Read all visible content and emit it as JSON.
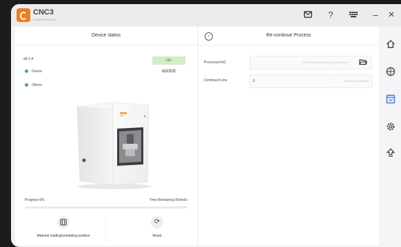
{
  "titlebar": {
    "app_name": "CNC3",
    "app_subtitle": "DOWNSTREAM",
    "icons": [
      "mail-icon",
      "help-icon",
      "keyboard-icon",
      "minimize-icon",
      "close-icon"
    ]
  },
  "device_panel": {
    "title": "Device status",
    "device_id": "s6-1-4",
    "status_items": [
      {
        "label": "Device",
        "color": "#4caf50"
      },
      {
        "label": "Others",
        "color": "#4caf50"
      }
    ],
    "state_badge": "Idle",
    "small_button": "解除警报",
    "progress_label": "Progress 0%",
    "progress_value": 0,
    "time_label": "Time Remaining 0h0m0s",
    "actions": [
      {
        "label": "Material loading/unloading position",
        "icon": "load-position-icon"
      },
      {
        "label": "Reset",
        "icon": "reset-icon"
      }
    ]
  },
  "process_panel": {
    "title": "Re-continue Process",
    "processed_nc": {
      "label": "Processed NC",
      "placeholder": "The NC file and path to be processed"
    },
    "continued_line": {
      "label": "Continued Line",
      "value": "0",
      "hint": "Continue processing"
    }
  },
  "sidebar": {
    "items": [
      {
        "icon": "home-icon"
      },
      {
        "icon": "globe-icon"
      },
      {
        "icon": "process-icon",
        "active": true
      },
      {
        "icon": "settings-icon"
      },
      {
        "icon": "upgrade-icon"
      }
    ]
  },
  "colors": {
    "accent": "#f07c1e",
    "idle_bg": "#d4ecc8",
    "idle_text": "#4a8e30",
    "active_icon": "#3a7bd5"
  }
}
